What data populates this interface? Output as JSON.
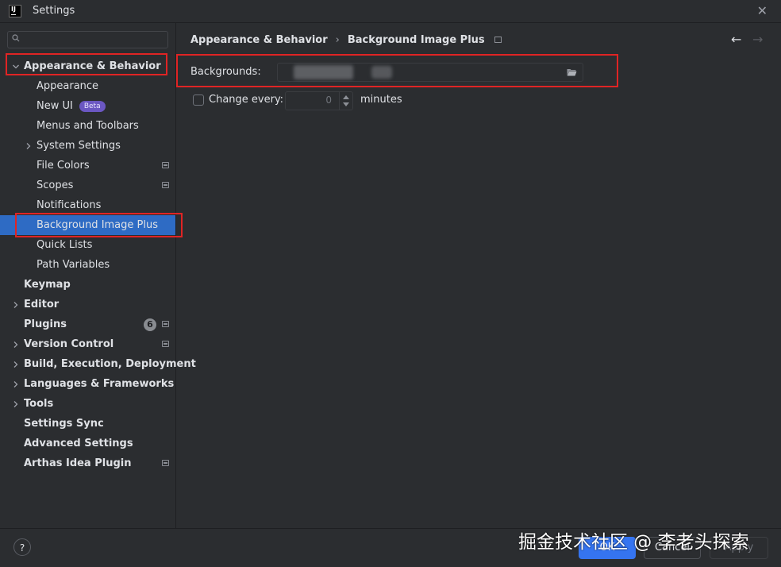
{
  "window": {
    "title": "Settings",
    "app_icon_text": "IJ"
  },
  "sidebar": {
    "search_placeholder": "",
    "items": [
      {
        "label": "Appearance & Behavior",
        "bold": true,
        "expanded": true
      },
      {
        "label": "Appearance"
      },
      {
        "label": "New UI",
        "badge": "Beta"
      },
      {
        "label": "Menus and Toolbars"
      },
      {
        "label": "System Settings",
        "collapsed": true
      },
      {
        "label": "File Colors",
        "has_settings_icon": true
      },
      {
        "label": "Scopes",
        "has_settings_icon": true
      },
      {
        "label": "Notifications"
      },
      {
        "label": "Background Image Plus",
        "selected": true
      },
      {
        "label": "Quick Lists"
      },
      {
        "label": "Path Variables"
      },
      {
        "label": "Keymap",
        "bold": true
      },
      {
        "label": "Editor",
        "bold": true,
        "collapsed": true
      },
      {
        "label": "Plugins",
        "bold": true,
        "count": "6",
        "has_settings_icon": true
      },
      {
        "label": "Version Control",
        "bold": true,
        "collapsed": true,
        "has_settings_icon": true
      },
      {
        "label": "Build, Execution, Deployment",
        "bold": true,
        "collapsed": true
      },
      {
        "label": "Languages & Frameworks",
        "bold": true,
        "collapsed": true
      },
      {
        "label": "Tools",
        "bold": true,
        "collapsed": true
      },
      {
        "label": "Settings Sync",
        "bold": true
      },
      {
        "label": "Advanced Settings",
        "bold": true
      },
      {
        "label": "Arthas Idea Plugin",
        "bold": true,
        "has_settings_icon": true
      }
    ]
  },
  "breadcrumb": {
    "parent": "Appearance & Behavior",
    "separator": "›",
    "current": "Background Image Plus"
  },
  "nav": {
    "back": "←",
    "forward": "→"
  },
  "form": {
    "backgrounds_label": "Backgrounds:",
    "change_every_label": "Change every:",
    "change_every_checked": false,
    "interval_value": "0",
    "interval_unit": "minutes"
  },
  "footer": {
    "help": "?",
    "ok": "OK",
    "cancel": "Cancel",
    "apply": "Apply"
  },
  "watermark": "掘金技术社区 @ 李老头探索",
  "colors": {
    "accent": "#3574f0",
    "selection": "#2e6bc4",
    "highlight_box": "#e02424",
    "beta_badge": "#6b57c2"
  }
}
